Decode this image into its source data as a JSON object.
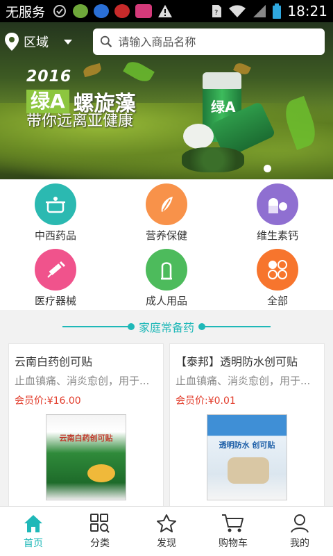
{
  "statusbar": {
    "carrier": "无服务",
    "time": "18:21"
  },
  "header": {
    "region_label": "区域",
    "search_placeholder": "请输入商品名称"
  },
  "banner": {
    "year": "2016",
    "brand_box": "绿A",
    "brand_name": "螺旋藻",
    "slogan": "带你远离亚健康",
    "bottle_label": "绿A"
  },
  "categories": [
    {
      "label": "中西药品",
      "icon": "pot-icon",
      "color": "#2bb9b1"
    },
    {
      "label": "营养保健",
      "icon": "supplement-icon",
      "color": "#f8924a"
    },
    {
      "label": "维生素钙",
      "icon": "pill-icon",
      "color": "#8f6fd1"
    },
    {
      "label": "医疗器械",
      "icon": "syringe-icon",
      "color": "#f0538c"
    },
    {
      "label": "成人用品",
      "icon": "condom-icon",
      "color": "#4dbb5c"
    },
    {
      "label": "全部",
      "icon": "grid-circles-icon",
      "color": "#f7752d"
    }
  ],
  "section": {
    "title": "家庭常备药"
  },
  "products": [
    {
      "title": "云南白药创可贴",
      "desc": "止血镇痛、消炎愈创，用于...",
      "price": "会员价:¥16.00",
      "box_label": "云南白药创可贴"
    },
    {
      "title": "【泰邦】透明防水创可贴",
      "desc": "止血镇痛、消炎愈创，用于...",
      "price": "会员价:¥0.01",
      "box_label": "透明防水 创可贴"
    }
  ],
  "nav": [
    {
      "label": "首页",
      "icon": "home-icon",
      "active": true
    },
    {
      "label": "分类",
      "icon": "category-icon",
      "active": false
    },
    {
      "label": "发现",
      "icon": "discover-icon",
      "active": false
    },
    {
      "label": "购物车",
      "icon": "cart-icon",
      "active": false
    },
    {
      "label": "我的",
      "icon": "user-icon",
      "active": false
    }
  ],
  "colors": {
    "accent": "#1fb8b8",
    "price": "#e23b2a"
  }
}
